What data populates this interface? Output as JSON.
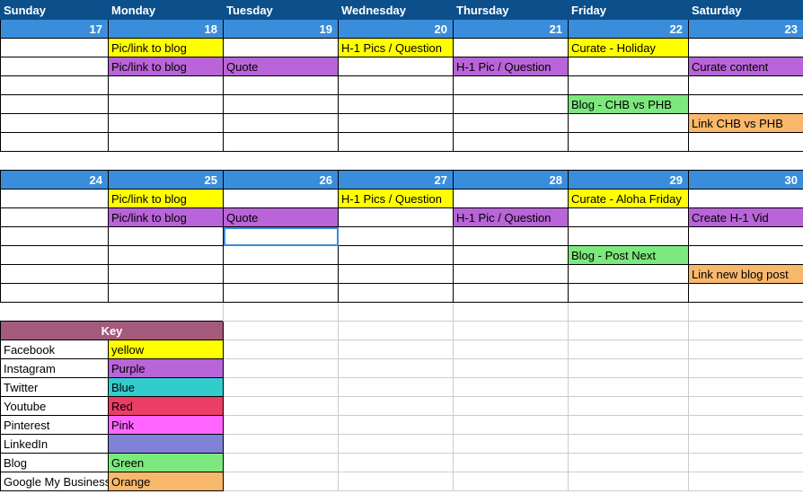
{
  "days": [
    "Sunday",
    "Monday",
    "Tuesday",
    "Wednesday",
    "Thursday",
    "Friday",
    "Saturday"
  ],
  "week1": {
    "dates": [
      "17",
      "18",
      "19",
      "20",
      "21",
      "22",
      "23"
    ],
    "r1": [
      "",
      "Pic/link to blog",
      "",
      "H-1 Pics / Question",
      "",
      "Curate - Holiday",
      ""
    ],
    "r2": [
      "",
      "Pic/link to blog",
      "Quote",
      "",
      "H-1 Pic / Question",
      "",
      "Curate content"
    ],
    "r3": [
      "",
      "",
      "",
      "",
      "",
      "",
      ""
    ],
    "r4": [
      "",
      "",
      "",
      "",
      "",
      "Blog - CHB vs PHB",
      ""
    ],
    "r5": [
      "",
      "",
      "",
      "",
      "",
      "",
      "Link CHB vs PHB"
    ],
    "r6": [
      "",
      "",
      "",
      "",
      "",
      "",
      ""
    ]
  },
  "week2": {
    "dates": [
      "24",
      "25",
      "26",
      "27",
      "28",
      "29",
      "30"
    ],
    "r1": [
      "",
      "Pic/link to blog",
      "",
      "H-1 Pics / Question",
      "",
      "Curate  - Aloha Friday",
      ""
    ],
    "r2": [
      "",
      "Pic/link to blog",
      "Quote",
      "",
      "H-1 Pic / Question",
      "",
      "Create H-1 Vid"
    ],
    "r3": [
      "",
      "",
      "",
      "",
      "",
      "",
      ""
    ],
    "r4": [
      "",
      "",
      "",
      "",
      "",
      "Blog - Post Next",
      ""
    ],
    "r5": [
      "",
      "",
      "",
      "",
      "",
      "",
      "Link new blog post"
    ],
    "r6": [
      "",
      "",
      "",
      "",
      "",
      "",
      ""
    ]
  },
  "key": {
    "title": "Key",
    "rows": [
      [
        "Facebook",
        "yellow"
      ],
      [
        "Instagram",
        "Purple"
      ],
      [
        "Twitter",
        "Blue"
      ],
      [
        "Youtube",
        "Red"
      ],
      [
        "Pinterest",
        "Pink"
      ],
      [
        "LinkedIn",
        ""
      ],
      [
        "Blog",
        "Green"
      ],
      [
        "Google My Business",
        "Orange"
      ]
    ]
  }
}
